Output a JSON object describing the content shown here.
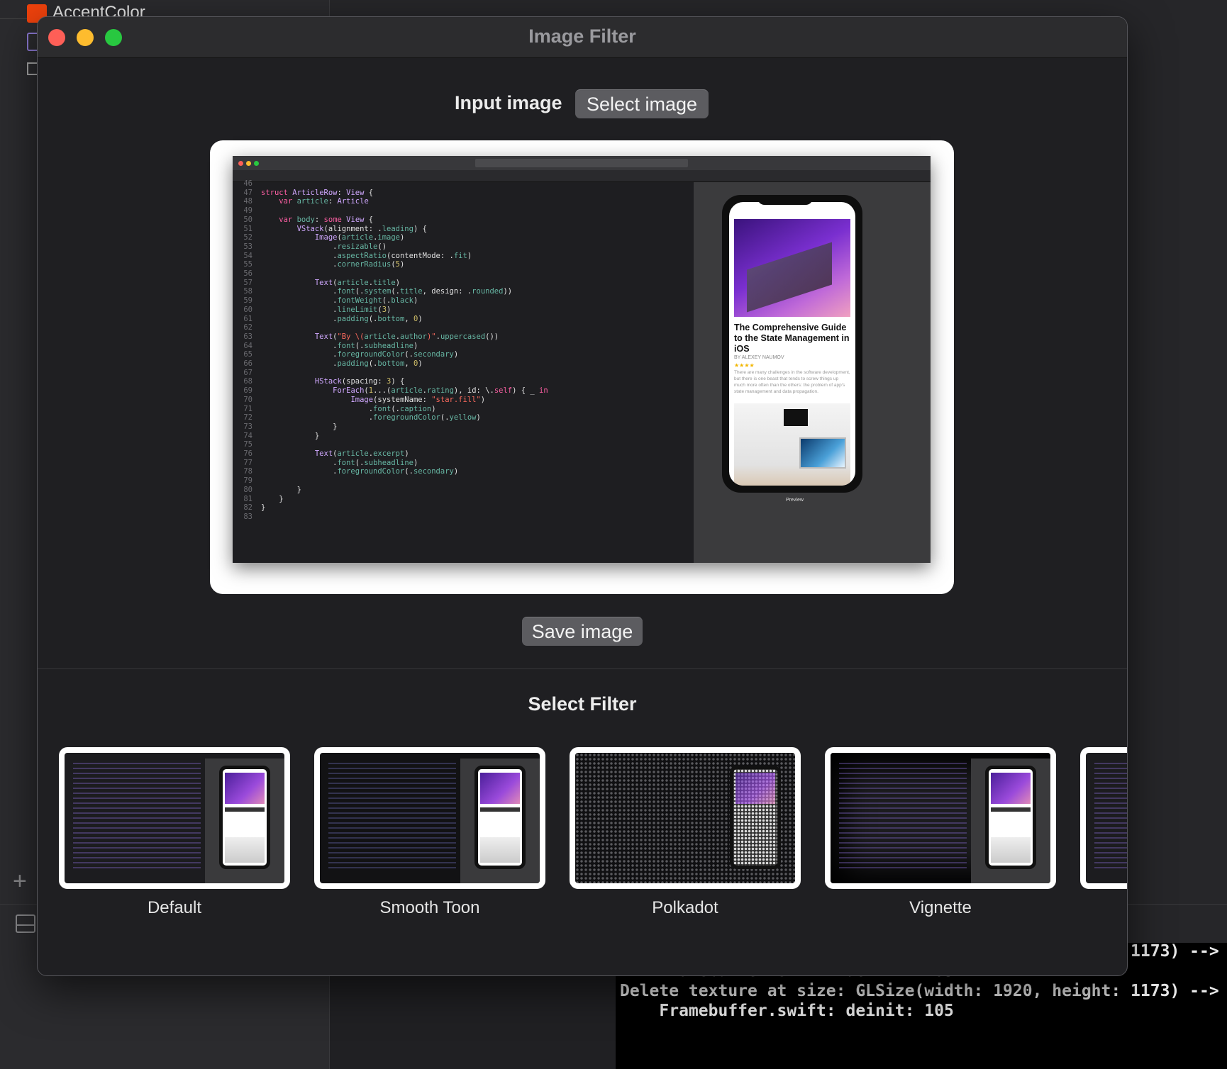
{
  "background": {
    "asset_name": "AccentColor",
    "console_lines": [
      "Delete texture at size: GLSize(width: 1920, height: 1173) -->",
      "    Framebuffer.swift: deinit: 105",
      "Delete texture at size: GLSize(width: 1920, height: 1173) -->",
      "    Framebuffer.swift: deinit: 105"
    ]
  },
  "window": {
    "title": "Image Filter",
    "input_label": "Input image",
    "select_button": "Select image",
    "save_button": "Save image",
    "filter_heading": "Select Filter",
    "filters": [
      {
        "label": "Default"
      },
      {
        "label": "Smooth Toon"
      },
      {
        "label": "Polkadot"
      },
      {
        "label": "Vignette"
      }
    ]
  },
  "preview": {
    "article_title": "The Comprehensive Guide to the State Management in iOS",
    "author": "BY ALEXEY NAUMOV",
    "stars": "★★★★",
    "excerpt": "There are many challenges in the software development, but there is one beast that tends to screw things up much more often than the others: the problem of app's state management and data propagation.",
    "preview_label": "Preview",
    "code_first_line": 46
  },
  "colors": {
    "close": "#fe5f57",
    "minimize": "#febc2e",
    "zoom": "#28c840",
    "accent_swatch": "#f0420c"
  }
}
